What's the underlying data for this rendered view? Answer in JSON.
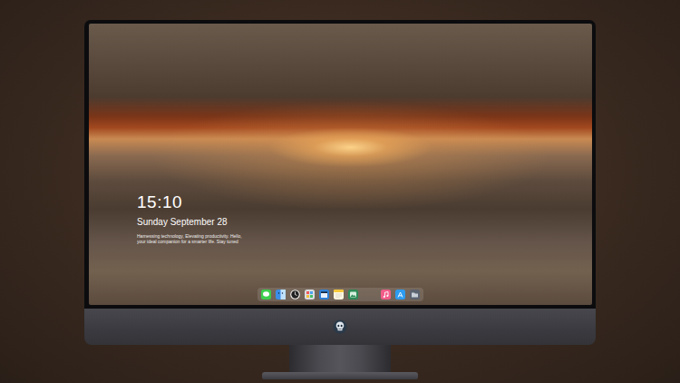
{
  "lock_screen": {
    "time": "15:10",
    "date": "Sunday September 28",
    "tagline": [
      "Harnessing technology, Elevating productivity. Hello,",
      "your ideal companion for a smarter life. Stay tuned"
    ]
  }
}
